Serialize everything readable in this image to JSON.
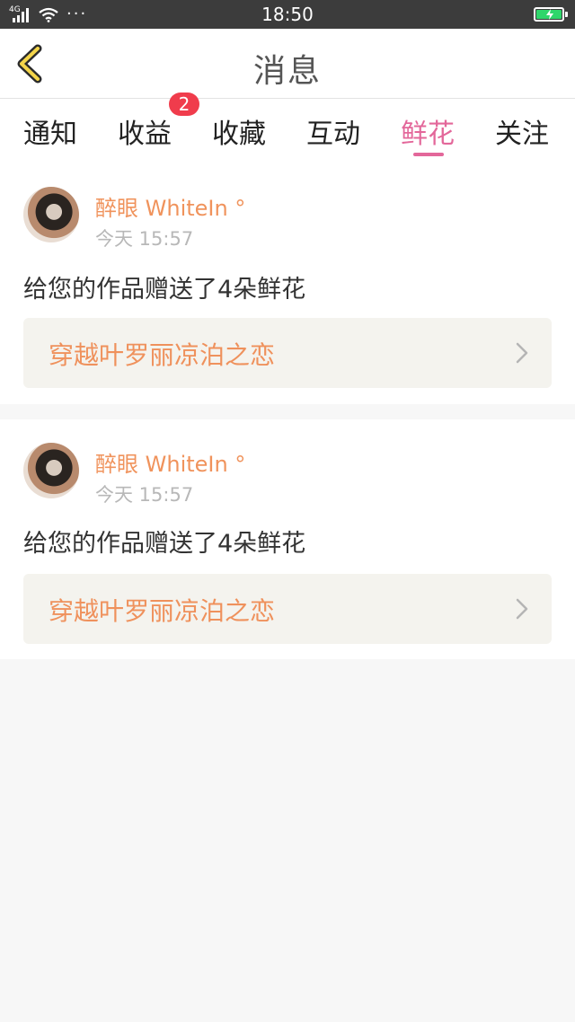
{
  "status_bar": {
    "network": "4G",
    "time": "18:50",
    "dots": "···"
  },
  "header": {
    "title": "消息"
  },
  "tabs": [
    {
      "label": "通知"
    },
    {
      "label": "收益",
      "badge": "2"
    },
    {
      "label": "收藏"
    },
    {
      "label": "互动"
    },
    {
      "label": "鲜花",
      "active": true
    },
    {
      "label": "关注"
    }
  ],
  "colors": {
    "accent_pink": "#e3679a",
    "name_orange": "#f0935c",
    "badge_red": "#f03c4c",
    "battery_green": "#2fd66b"
  },
  "messages": [
    {
      "user_name": "醉眼 WhiteIn °",
      "time": "今天 15:57",
      "description": "给您的作品赠送了4朵鲜花",
      "work_title": "穿越叶罗丽凉泊之恋",
      "icon": "chevron-right-icon"
    },
    {
      "user_name": "醉眼 WhiteIn °",
      "time": "今天 15:57",
      "description": "给您的作品赠送了4朵鲜花",
      "work_title": "穿越叶罗丽凉泊之恋",
      "icon": "chevron-right-icon"
    }
  ]
}
